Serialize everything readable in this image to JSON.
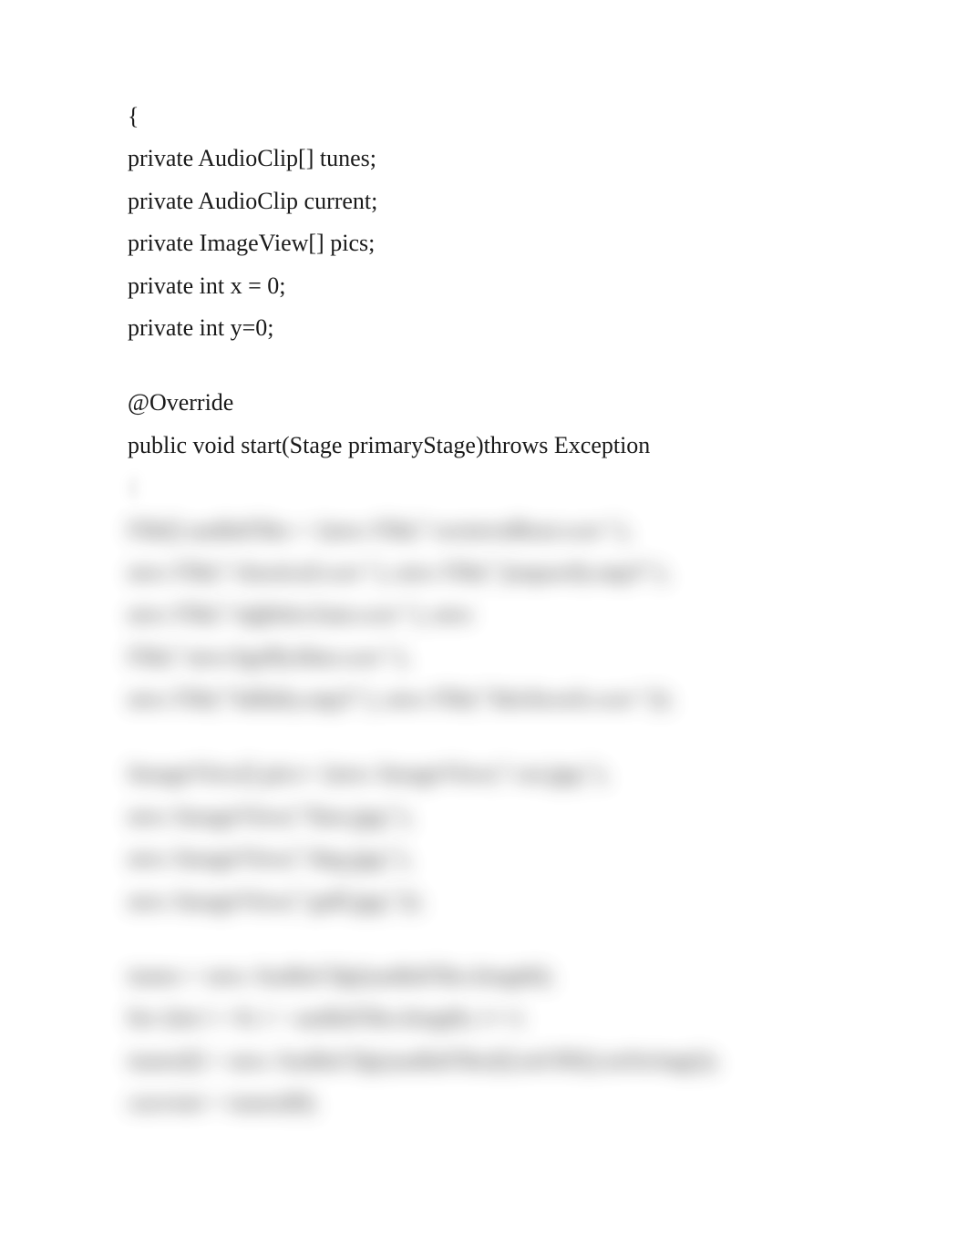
{
  "clear_code": {
    "line1": "{",
    "line2": "private AudioClip[] tunes;",
    "line3": "private AudioClip current;",
    "line4": "private ImageView[] pics;",
    "line5": "private int x = 0;",
    "line6": "private int y=0;",
    "line7": "@Override",
    "line8": "public void start(Stage primaryStage)throws Exception"
  },
  "blurred_code": {
    "b0": "{",
    "b1": "File[] audioFiles = {new File(\"westernBeat.wav\"),",
    "b2": "new File(\"classical.wav\"), new File(\"jeopardy.mp3\"),",
    "b3": "new File(\"eightiesJam.wav\"), new",
    "b4": "File(\"newAgeRythm.wav\"),",
    "b5": "new File(\"lullaby.mp3\"), new File(\"hitchcock.wav\")};",
    "b6": "ImageView[] pics= {new ImageView(\"cat.jpg\"),",
    "b7": "new ImageView(\"lion.jpg\"),",
    "b8": "new ImageView(\"dog.jpg\"),",
    "b9": "new ImageView(\"golf.jpg\")};",
    "b10": "tunes = new AudioClip[audioFiles.length];",
    "b11": "for (int i = 0; i < audioFiles.length; i++)",
    "b12": "tunes[i] = new AudioClip(audioFiles[i].toURI().toString());",
    "b13": "current = tunes[0];"
  }
}
